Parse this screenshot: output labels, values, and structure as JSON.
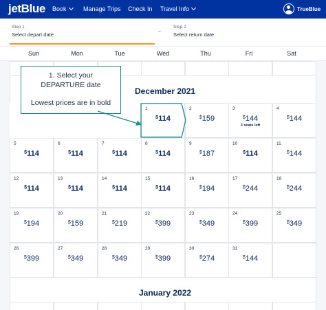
{
  "header": {
    "logo": "jetBlue",
    "nav": [
      {
        "label": "Book",
        "has_dropdown": true
      },
      {
        "label": "Manage Trips",
        "has_dropdown": false
      },
      {
        "label": "Check In",
        "has_dropdown": false
      },
      {
        "label": "Travel Info",
        "has_dropdown": true
      }
    ],
    "trueblue_label": "TrueBlue",
    "trueblue_icon": "user-circle-icon"
  },
  "steps": [
    {
      "label": "Step 1",
      "text": "Select depart date",
      "active": true
    },
    {
      "label": "Step 2",
      "text": "Select return date",
      "active": false
    }
  ],
  "step_arrow": "→",
  "weekdays": [
    "Sun",
    "Mon",
    "Tue",
    "Wed",
    "Thu",
    "Fri",
    "Sat"
  ],
  "callout": {
    "lines": [
      "1. Select your",
      "DEPARTURE date",
      "Lowest prices are in bold"
    ]
  },
  "months": [
    {
      "title": "December 2021",
      "days": [
        {
          "day": "1",
          "price": "114",
          "bold": true,
          "selected": true
        },
        {
          "day": "2",
          "price": "159",
          "bold": false
        },
        {
          "day": "3",
          "price": "144",
          "bold": false,
          "note": "3 seats left"
        },
        {
          "day": "4",
          "price": "144",
          "bold": false
        },
        {
          "day": "5",
          "price": "114",
          "bold": true
        },
        {
          "day": "6",
          "price": "114",
          "bold": true
        },
        {
          "day": "7",
          "price": "114",
          "bold": true
        },
        {
          "day": "8",
          "price": "114",
          "bold": true
        },
        {
          "day": "9",
          "price": "187",
          "bold": false
        },
        {
          "day": "10",
          "price": "114",
          "bold": true
        },
        {
          "day": "11",
          "price": "144",
          "bold": false
        },
        {
          "day": "12",
          "price": "114",
          "bold": true
        },
        {
          "day": "13",
          "price": "114",
          "bold": true
        },
        {
          "day": "14",
          "price": "114",
          "bold": true
        },
        {
          "day": "15",
          "price": "114",
          "bold": true
        },
        {
          "day": "16",
          "price": "194",
          "bold": false
        },
        {
          "day": "17",
          "price": "244",
          "bold": false
        },
        {
          "day": "18",
          "price": "244",
          "bold": false
        },
        {
          "day": "19",
          "price": "194",
          "bold": false
        },
        {
          "day": "20",
          "price": "159",
          "bold": false
        },
        {
          "day": "21",
          "price": "219",
          "bold": false
        },
        {
          "day": "22",
          "price": "399",
          "bold": false
        },
        {
          "day": "23",
          "price": "349",
          "bold": false
        },
        {
          "day": "24",
          "price": "399",
          "bold": false
        },
        {
          "day": "25",
          "price": "349",
          "bold": false
        },
        {
          "day": "26",
          "price": "399",
          "bold": false
        },
        {
          "day": "27",
          "price": "349",
          "bold": false
        },
        {
          "day": "28",
          "price": "349",
          "bold": false
        },
        {
          "day": "29",
          "price": "399",
          "bold": false
        },
        {
          "day": "30",
          "price": "274",
          "bold": false
        },
        {
          "day": "31",
          "price": "144",
          "bold": false
        }
      ]
    },
    {
      "title": "January 2022",
      "days": []
    }
  ],
  "colors": {
    "brand_blue": "#0033a0",
    "step_accent": "#f7931e",
    "callout_border": "#1b8a8f",
    "text_navy": "#0a2656"
  }
}
